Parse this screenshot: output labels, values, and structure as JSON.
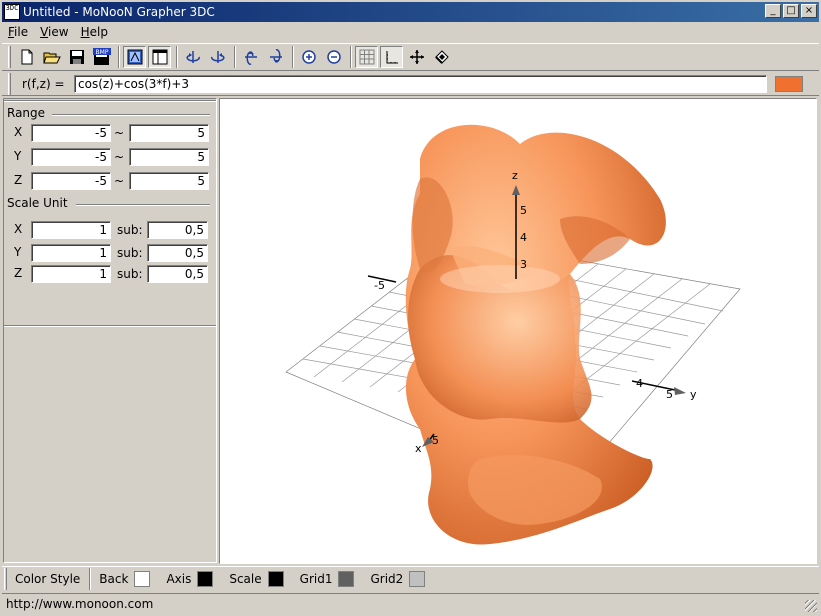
{
  "window": {
    "app_icon_text": "3DC",
    "title": "Untitled - MoNooN Grapher 3DC",
    "min_label": "_",
    "max_label": "□",
    "close_label": "×"
  },
  "menu": {
    "items": [
      {
        "label": "File"
      },
      {
        "label": "View"
      },
      {
        "label": "Help"
      }
    ]
  },
  "toolbar": {
    "icons": [
      "new-file-icon",
      "open-folder-icon",
      "save-icon",
      "save-bmp-icon",
      "view-3d-icon",
      "panel-toggle-icon",
      "rotate-left-icon",
      "rotate-right-icon",
      "rotate-up-icon",
      "rotate-down-icon",
      "zoom-in-icon",
      "zoom-out-icon",
      "grid-icon",
      "axis-icon",
      "move-icon",
      "fill-icon"
    ],
    "bmp_label": "BMP"
  },
  "formula": {
    "label": "r(f,z) =",
    "value": "cos(z)+cos(3*f)+3",
    "color": "#f07030"
  },
  "range": {
    "title": "Range",
    "separator": "~",
    "rows": [
      {
        "axis": "X",
        "min": "-5",
        "max": "5"
      },
      {
        "axis": "Y",
        "min": "-5",
        "max": "5"
      },
      {
        "axis": "Z",
        "min": "-5",
        "max": "5"
      }
    ]
  },
  "scale_unit": {
    "title": "Scale Unit",
    "sub_label": "sub:",
    "rows": [
      {
        "axis": "X",
        "unit": "1",
        "sub": "0,5"
      },
      {
        "axis": "Y",
        "unit": "1",
        "sub": "0,5"
      },
      {
        "axis": "Z",
        "unit": "1",
        "sub": "0,5"
      }
    ]
  },
  "graph": {
    "surface_color": "#f6955a",
    "axis_labels": {
      "x": "x",
      "y": "y",
      "z": "z"
    },
    "ticks": {
      "z": [
        "5",
        "4",
        "3"
      ],
      "x": "5",
      "x_neg": "-5",
      "y": "5",
      "y_near": "4"
    }
  },
  "color_style": {
    "label": "Color Style",
    "items": [
      {
        "label": "Back",
        "color": "#ffffff"
      },
      {
        "label": "Axis",
        "color": "#000000"
      },
      {
        "label": "Scale",
        "color": "#000000"
      },
      {
        "label": "Grid1",
        "color": "#606060"
      },
      {
        "label": "Grid2",
        "color": "#c0c0c0"
      }
    ]
  },
  "status": {
    "url": "http://www.monoon.com"
  }
}
